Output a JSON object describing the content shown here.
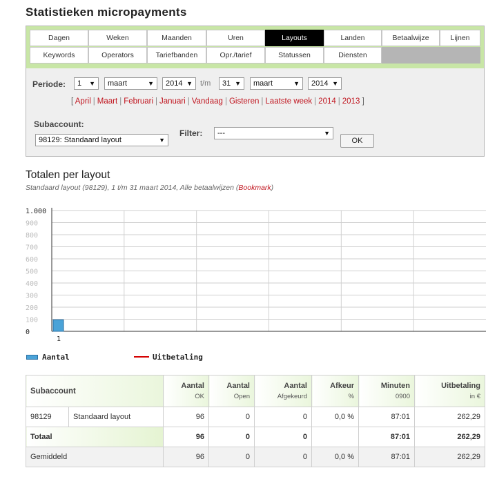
{
  "page": {
    "title": "Statistieken micropayments"
  },
  "tabs": {
    "row1": [
      "Dagen",
      "Weken",
      "Maanden",
      "Uren",
      "Layouts",
      "Landen",
      "Betaalwijze",
      "Lijnen"
    ],
    "row2": [
      "Keywords",
      "Operators",
      "Tariefbanden",
      "Opr./tarief",
      "Statussen",
      "Diensten"
    ],
    "active": "Layouts"
  },
  "periode": {
    "label": "Periode:",
    "from_day": "1",
    "from_month": "maart",
    "from_year": "2014",
    "tm": "t/m",
    "to_day": "31",
    "to_month": "maart",
    "to_year": "2014"
  },
  "quick_links": {
    "open": "[",
    "close": "]",
    "sep": "|",
    "items": [
      "April",
      "Maart",
      "Februari",
      "Januari",
      "Vandaag",
      "Gisteren",
      "Laatste week",
      "2014",
      "2013"
    ]
  },
  "subaccount": {
    "label": "Subaccount:",
    "value": "98129: Standaard layout"
  },
  "filter": {
    "label": "Filter:",
    "value": "---"
  },
  "ok_label": "OK",
  "section": {
    "title": "Totalen per layout",
    "subtitle": "Standaard layout (98129), 1 t/m 31 maart 2014, Alle betaalwijzen",
    "bookmark_open": "(",
    "bookmark": "Bookmark",
    "bookmark_close": ")"
  },
  "chart_data": {
    "type": "bar",
    "categories": [
      "1"
    ],
    "series": [
      {
        "name": "Aantal",
        "values": [
          96
        ],
        "color": "#4aa3d8"
      },
      {
        "name": "Uitbetaling",
        "values": [
          262.29
        ],
        "color": "#d40000"
      }
    ],
    "y_ticks": [
      "0",
      "100",
      "200",
      "300",
      "400",
      "500",
      "600",
      "700",
      "800",
      "900",
      "1.000"
    ],
    "ylim": [
      0,
      1000
    ],
    "grid": true,
    "legend_position": "bottom-left"
  },
  "legend": {
    "aantal": "Aantal",
    "uitbetaling": "Uitbetaling"
  },
  "table": {
    "headers": {
      "subaccount": "Subaccount",
      "aantal_ok": {
        "top": "Aantal",
        "sub": "OK"
      },
      "aantal_open": {
        "top": "Aantal",
        "sub": "Open"
      },
      "aantal_afgekeurd": {
        "top": "Aantal",
        "sub": "Afgekeurd"
      },
      "afkeur": {
        "top": "Afkeur",
        "sub": "%"
      },
      "minuten": {
        "top": "Minuten",
        "sub": "0900"
      },
      "uitbetaling": {
        "top": "Uitbetaling",
        "sub": "in €"
      }
    },
    "row": {
      "id": "98129",
      "name": "Standaard layout",
      "ok": "96",
      "open": "0",
      "afgekeurd": "0",
      "afkeur": "0,0 %",
      "minuten": "87:01",
      "uitbetaling": "262,29"
    },
    "totaal": {
      "label": "Totaal",
      "ok": "96",
      "open": "0",
      "afgekeurd": "0",
      "afkeur": "",
      "minuten": "87:01",
      "uitbetaling": "262,29"
    },
    "gemiddeld": {
      "label": "Gemiddeld",
      "ok": "96",
      "open": "0",
      "afgekeurd": "0",
      "afkeur": "0,0 %",
      "minuten": "87:01",
      "uitbetaling": "262,29"
    }
  }
}
